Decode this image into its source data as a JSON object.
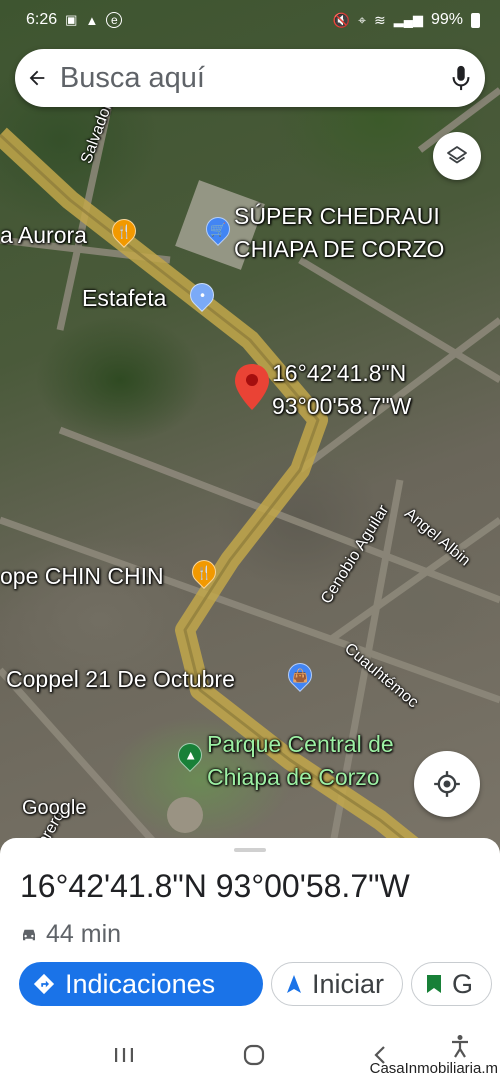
{
  "status_bar": {
    "time": "6:26",
    "battery": "99%"
  },
  "search": {
    "placeholder": "Busca aquí"
  },
  "map": {
    "pin_coords_line1": "16°42'41.8\"N",
    "pin_coords_line2": "93°00'58.7\"W",
    "labels": {
      "aurora": "a Aurora",
      "chedraui_line1": "SÚPER CHEDRAUI",
      "chedraui_line2": "CHIAPA DE CORZO",
      "estafeta": "Estafeta",
      "chin_chin": "ope CHIN CHIN",
      "coppel": "Coppel 21 De Octubre",
      "parque_line1": "Parque Central de",
      "parque_line2": "Chiapa de Corzo",
      "street_salvador": "Salvador",
      "street_cenobio": "Cenobio Aguilar",
      "street_angel": "Angel Albin",
      "street_cuauhtemoc": "Cuauhtémoc",
      "street_febrero": "ebrero",
      "google": "Google"
    }
  },
  "sheet": {
    "title": "16°42'41.8\"N 93°00'58.7\"W",
    "drive_time": "44 min",
    "actions": {
      "directions": "Indicaciones",
      "start": "Iniciar",
      "save": "G"
    }
  },
  "watermark": "CasaInmobiliaria.m",
  "colors": {
    "accent": "#1a73e8",
    "pin": "#ea4335",
    "road": "#c2a74a"
  }
}
